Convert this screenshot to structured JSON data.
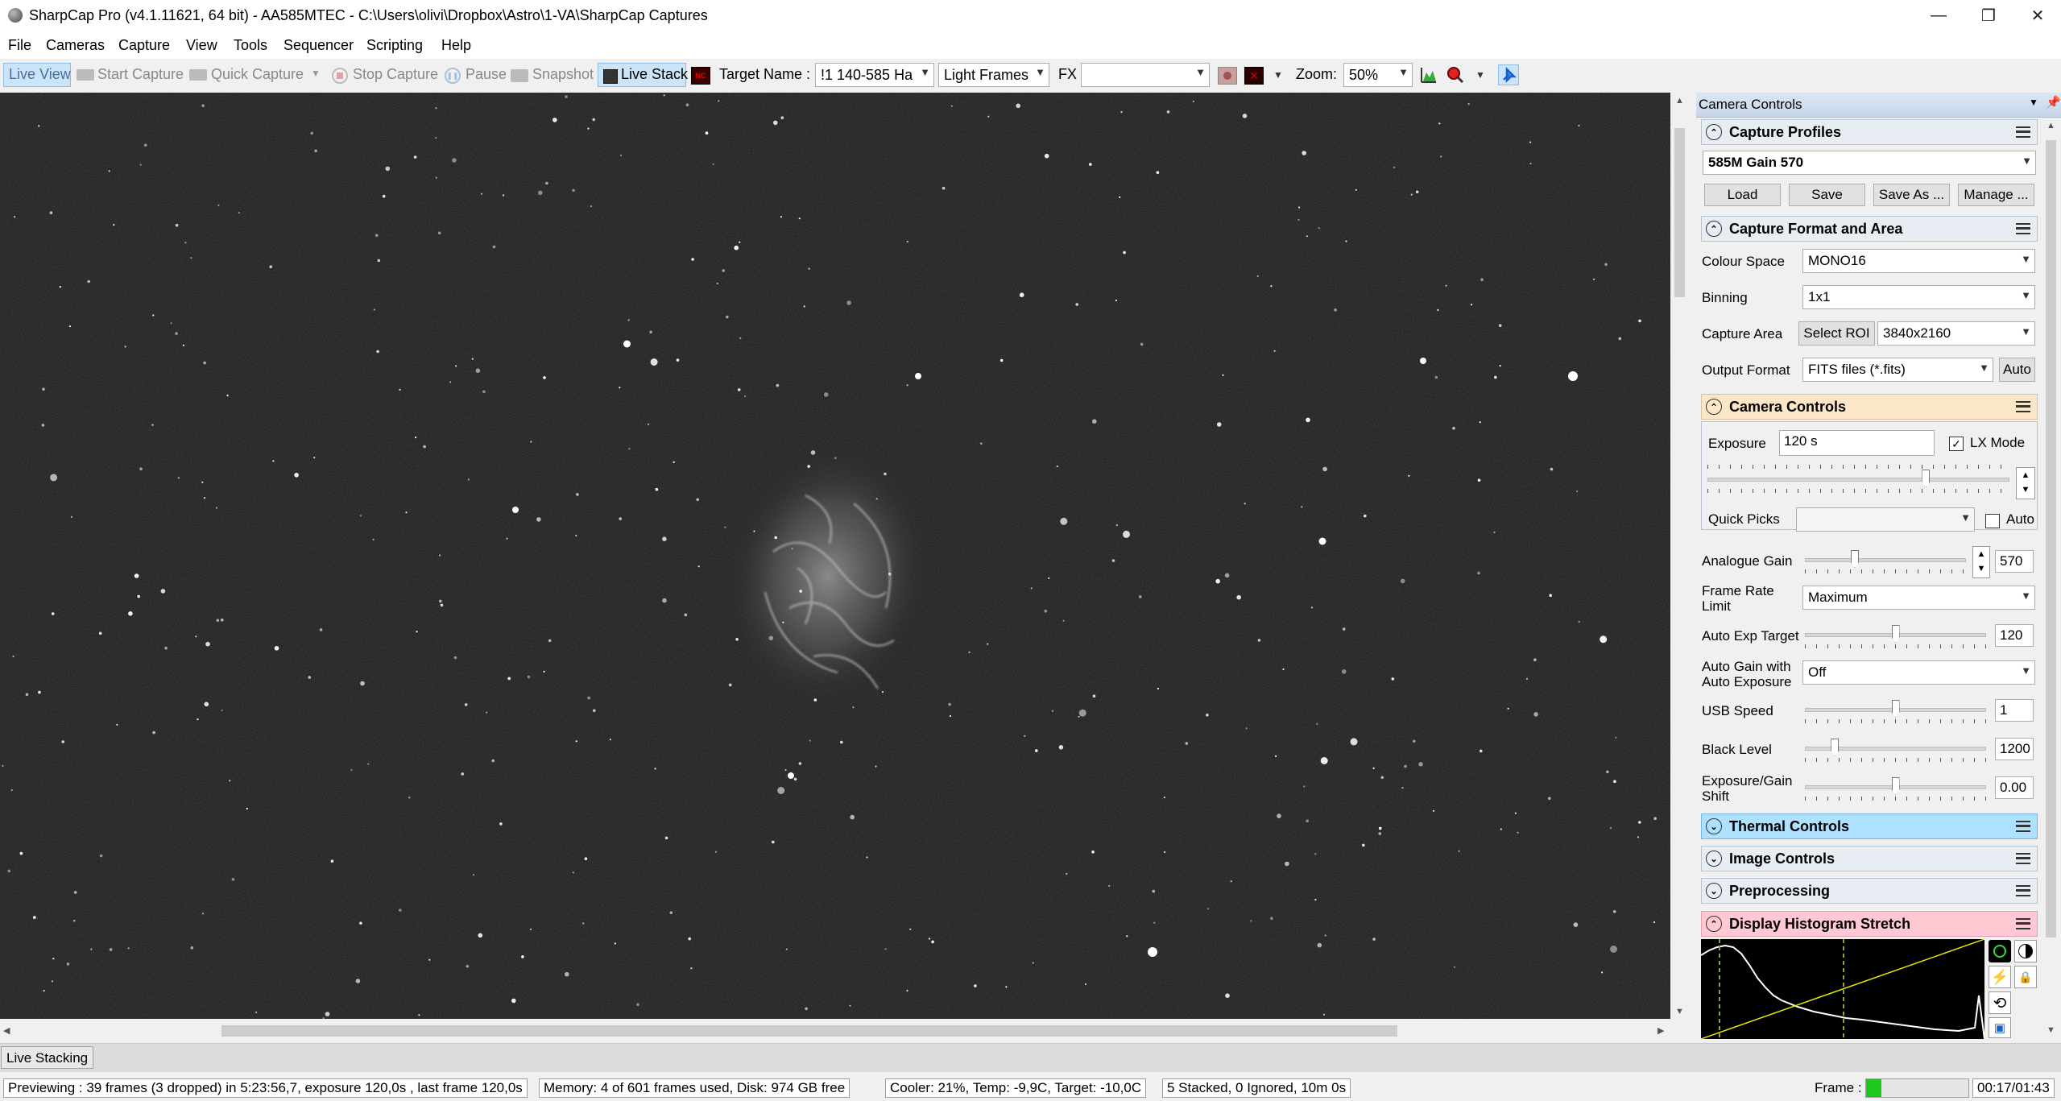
{
  "window": {
    "title": "SharpCap Pro (v4.1.11621, 64 bit) - AA585MTEC - C:\\Users\\olivi\\Dropbox\\Astro\\1-VA\\SharpCap Captures",
    "minimize_glyph": "—",
    "restore_glyph": "❐",
    "close_glyph": "✕"
  },
  "menu": [
    "File",
    "Cameras",
    "Capture",
    "View",
    "Tools",
    "Sequencer",
    "Scripting",
    "Help"
  ],
  "toolbar": {
    "live_view": "Live View",
    "start_capture": "Start Capture",
    "quick_capture": "Quick Capture",
    "stop_capture": "Stop Capture",
    "pause": "Pause",
    "snapshot": "Snapshot",
    "live_stack": "Live Stack",
    "target_name_label": "Target Name :",
    "target_name_value": "!1 140-585 Ha",
    "frame_type": "Light Frames",
    "fx_label": "FX",
    "fx_value": "",
    "zoom_label": "Zoom:",
    "zoom_value": "50%"
  },
  "panel": {
    "title": "Camera Controls",
    "capture_profiles": {
      "header": "Capture Profiles",
      "selected": "585M Gain 570",
      "load": "Load",
      "save": "Save",
      "save_as": "Save As ...",
      "manage": "Manage ..."
    },
    "format_area": {
      "header": "Capture Format and Area",
      "colour_space_label": "Colour Space",
      "colour_space": "MONO16",
      "binning_label": "Binning",
      "binning": "1x1",
      "capture_area_label": "Capture Area",
      "select_roi": "Select ROI",
      "capture_area": "3840x2160",
      "output_format_label": "Output Format",
      "output_format": "FITS files (*.fits)",
      "auto": "Auto"
    },
    "camera_controls": {
      "header": "Camera Controls",
      "exposure_label": "Exposure",
      "exposure": "120 s",
      "lx_mode": "LX Mode",
      "lx_mode_checked": true,
      "exposure_level": 0.73,
      "quick_picks_label": "Quick Picks",
      "quick_picks": "",
      "quick_picks_auto": "Auto",
      "analogue_gain_label": "Analogue Gain",
      "analogue_gain": "570",
      "analogue_gain_level": 0.3,
      "frame_rate_label_1": "Frame Rate",
      "frame_rate_label_2": "Limit",
      "frame_rate": "Maximum",
      "auto_exp_target_label": "Auto Exp Target",
      "auto_exp_target": "120",
      "auto_exp_target_level": 0.5,
      "auto_gain_label_1": "Auto Gain with",
      "auto_gain_label_2": "Auto Exposure",
      "auto_gain": "Off",
      "usb_speed_label": "USB Speed",
      "usb_speed": "1",
      "usb_speed_level": 0.5,
      "black_level_label": "Black Level",
      "black_level": "1200",
      "black_level_level": 0.15,
      "exp_gain_shift_label_1": "Exposure/Gain",
      "exp_gain_shift_label_2": "Shift",
      "exp_gain_shift": "0.00",
      "exp_gain_shift_level": 0.5
    },
    "thermal_controls": "Thermal Controls",
    "image_controls": "Image Controls",
    "preprocessing": "Preprocessing",
    "display_histogram": "Display Histogram Stretch"
  },
  "status": {
    "live_stacking_tab": "Live Stacking",
    "previewing": "Previewing : 39 frames (3 dropped) in 5:23:56,7, exposure 120,0s , last frame 120,0s",
    "memory": "Memory: 4 of 601 frames used, Disk: 974 GB free",
    "cooler": "Cooler: 21%, Temp: -9,9C, Target: -10,0C",
    "stacked": "5 Stacked, 0 Ignored, 10m 0s",
    "frame_label": "Frame :",
    "frame_progress": 0.15,
    "timer": "00:17/01:43"
  },
  "colors": {
    "accent": "#0a64d2",
    "thermal_header": "#aee0ff",
    "camera_header": "#fbe6c8",
    "histogram_header": "#ffc8d2",
    "frame_progress": "#1ec81e"
  }
}
